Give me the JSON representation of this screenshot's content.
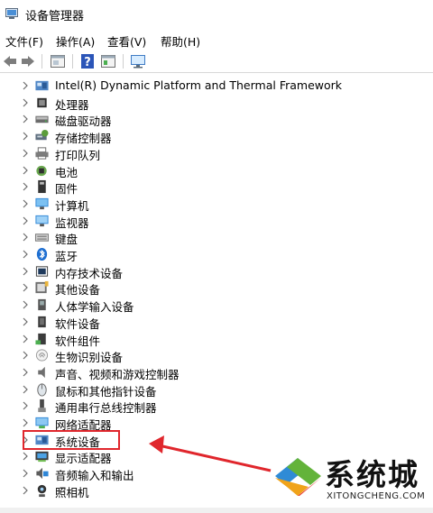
{
  "window": {
    "title": "设备管理器"
  },
  "menu": [
    {
      "label": "文件(F)"
    },
    {
      "label": "操作(A)"
    },
    {
      "label": "查看(V)"
    },
    {
      "label": "帮助(H)"
    }
  ],
  "toolbar": {
    "buttons": [
      "back-icon",
      "forward-icon",
      "properties-icon",
      "help-icon",
      "view-icon",
      "monitor-scan-icon"
    ]
  },
  "tree": {
    "items": [
      {
        "label": "Intel(R) Dynamic Platform and Thermal Framework",
        "icon": "system-device-icon"
      },
      {
        "label": "处理器",
        "icon": "processor-icon"
      },
      {
        "label": "磁盘驱动器",
        "icon": "disk-drive-icon"
      },
      {
        "label": "存储控制器",
        "icon": "storage-controller-icon"
      },
      {
        "label": "打印队列",
        "icon": "printer-icon"
      },
      {
        "label": "电池",
        "icon": "battery-icon"
      },
      {
        "label": "固件",
        "icon": "firmware-icon"
      },
      {
        "label": "计算机",
        "icon": "computer-icon"
      },
      {
        "label": "监视器",
        "icon": "monitor-icon"
      },
      {
        "label": "键盘",
        "icon": "keyboard-icon"
      },
      {
        "label": "蓝牙",
        "icon": "bluetooth-icon"
      },
      {
        "label": "内存技术设备",
        "icon": "memory-device-icon"
      },
      {
        "label": "其他设备",
        "icon": "other-device-icon"
      },
      {
        "label": "人体学输入设备",
        "icon": "hid-icon"
      },
      {
        "label": "软件设备",
        "icon": "software-device-icon"
      },
      {
        "label": "软件组件",
        "icon": "software-component-icon"
      },
      {
        "label": "生物识别设备",
        "icon": "biometric-icon"
      },
      {
        "label": "声音、视频和游戏控制器",
        "icon": "speaker-icon"
      },
      {
        "label": "鼠标和其他指针设备",
        "icon": "mouse-icon"
      },
      {
        "label": "通用串行总线控制器",
        "icon": "usb-icon"
      },
      {
        "label": "网络适配器",
        "icon": "network-adapter-icon"
      },
      {
        "label": "系统设备",
        "icon": "system-device-icon"
      },
      {
        "label": "显示适配器",
        "icon": "display-adapter-icon"
      },
      {
        "label": "音频输入和输出",
        "icon": "audio-io-icon"
      },
      {
        "label": "照相机",
        "icon": "camera-icon"
      }
    ]
  },
  "annotation": {
    "highlighted_item": "系统设备",
    "color": "#e0262c"
  },
  "watermark": {
    "brand": "系统城",
    "url": "XITONGCHENG.COM"
  }
}
